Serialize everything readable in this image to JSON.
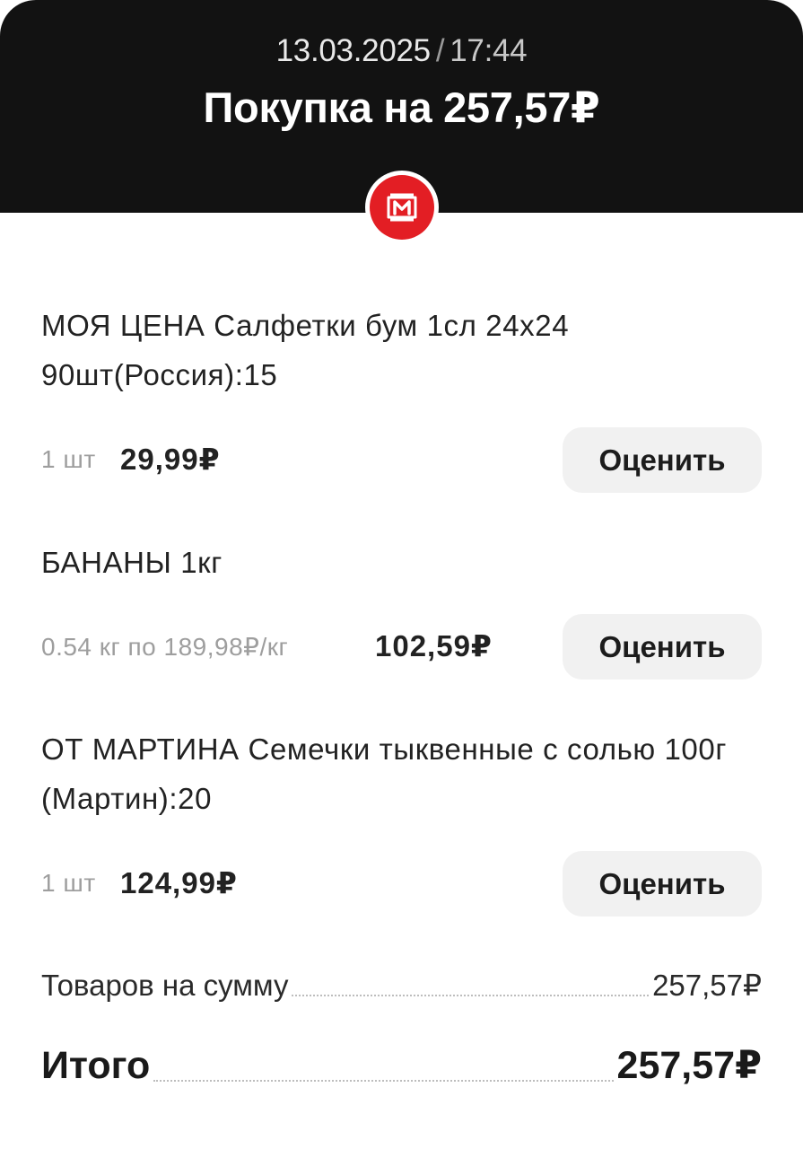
{
  "header": {
    "date": "13.03.2025",
    "separator": "/",
    "time": "17:44",
    "title": "Покупка на 257,57₽",
    "background_color": "#121212",
    "store_logo": {
      "icon": "magnit-logo-icon",
      "text": "М",
      "color": "#e31e24"
    }
  },
  "items": [
    {
      "name": "МОЯ ЦЕНА Салфетки бум 1сл 24х24 90шт(Россия):15",
      "quantity": "1 шт",
      "price": "29,99₽",
      "rate_label": "Оценить"
    },
    {
      "name": "БАНАНЫ 1кг",
      "quantity": "0.54 кг по 189,98₽/кг",
      "price": "102,59₽",
      "rate_label": "Оценить"
    },
    {
      "name": "ОТ МАРТИНА Семечки тыквенные с солью 100г (Мартин):20",
      "quantity": "1 шт",
      "price": "124,99₽",
      "rate_label": "Оценить"
    }
  ],
  "summary": {
    "subtotal_label": "Товаров на сумму",
    "subtotal_value": "257,57₽",
    "total_label": "Итого",
    "total_value": "257,57₽"
  }
}
